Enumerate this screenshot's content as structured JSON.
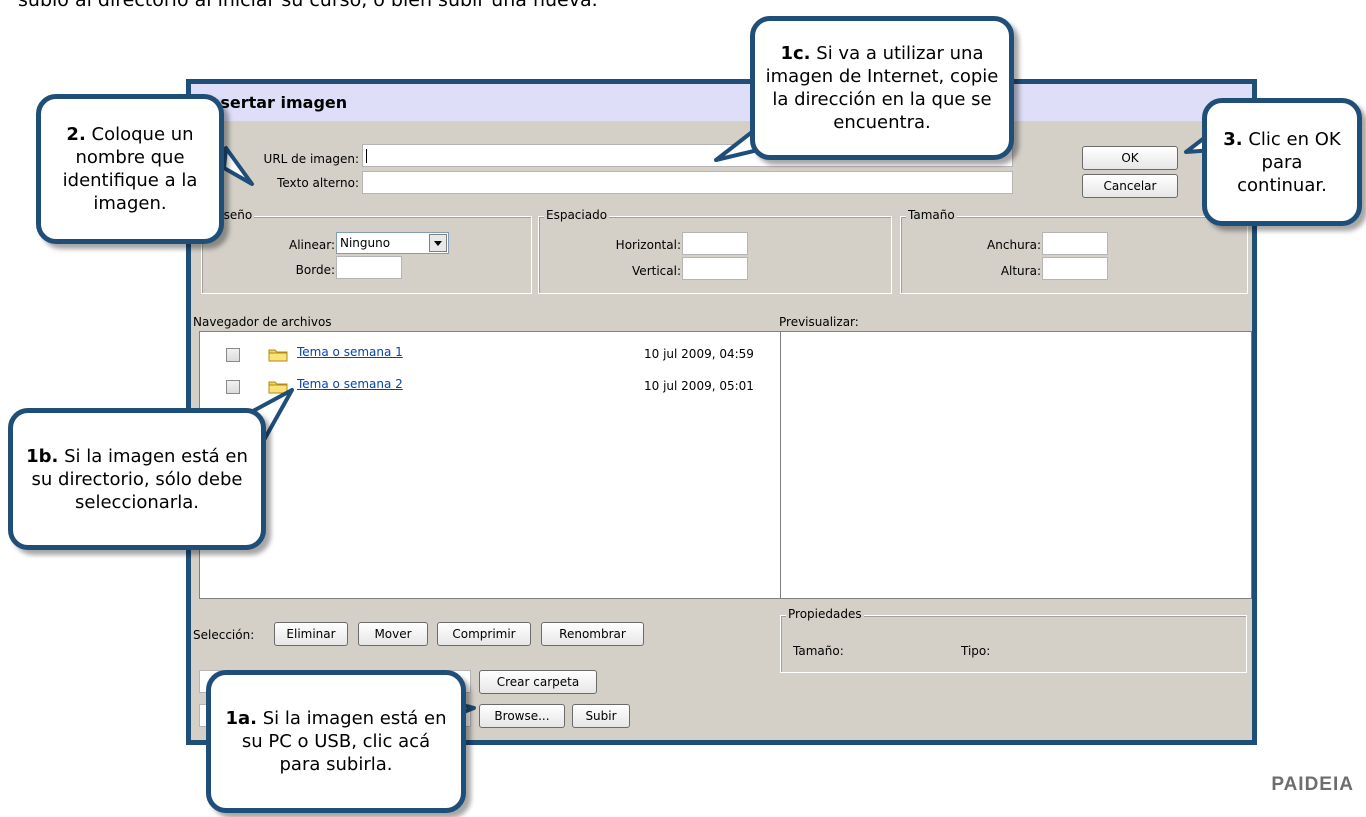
{
  "intro_text": "subió al directorio al iniciar su curso, o bien subir una nueva.",
  "dialog": {
    "title": "Insertar imagen",
    "url_label": "URL de imagen:",
    "url_value": "",
    "alt_label": "Texto alterno:",
    "alt_value": "",
    "ok_label": "OK",
    "cancel_label": "Cancelar",
    "layout_group_title": "Diseño",
    "align_label": "Alinear:",
    "align_value": "Ninguno",
    "border_label": "Borde:",
    "spacing_group_title": "Espaciado",
    "horizontal_label": "Horizontal:",
    "vertical_label": "Vertical:",
    "size_group_title": "Tamaño",
    "width_label": "Anchura:",
    "height_label": "Altura:",
    "browser_title": "Navegador de archivos",
    "preview_title": "Previsualizar:",
    "files": [
      {
        "name": "Tema o semana 1",
        "date": "10 jul 2009, 04:59"
      },
      {
        "name": "Tema o semana 2",
        "date": "10 jul 2009, 05:01"
      }
    ],
    "selection_label": "Selección:",
    "delete_label": "Eliminar",
    "move_label": "Mover",
    "zip_label": "Comprimir",
    "rename_label": "Renombrar",
    "properties_title": "Propiedades",
    "prop_size_label": "Tamaño:",
    "prop_type_label": "Tipo:",
    "create_folder_label": "Crear carpeta",
    "browse_label": "Browse...",
    "upload_label": "Subir"
  },
  "callouts": {
    "c2_bold": "2.",
    "c2_text": "Coloque un nombre que identifique a la imagen.",
    "c1c_bold": "1c.",
    "c1c_text": "Si va a utilizar una imagen de Internet, copie la dirección en la que se encuentra.",
    "c3_bold": "3.",
    "c3_text": "Clic en OK para continuar.",
    "c1b_bold": "1b.",
    "c1b_text": "Si la imagen está en su directorio, sólo debe seleccionarla.",
    "c1a_bold": "1a.",
    "c1a_text": "Si la imagen está en su PC o USB, clic acá para subirla."
  },
  "brand": "PAIDEIA",
  "colors": {
    "callout_border": "#1f4e79",
    "dialog_bg": "#d4d0c8",
    "titlebar_bg": "#dedef8",
    "link": "#0645ad"
  }
}
